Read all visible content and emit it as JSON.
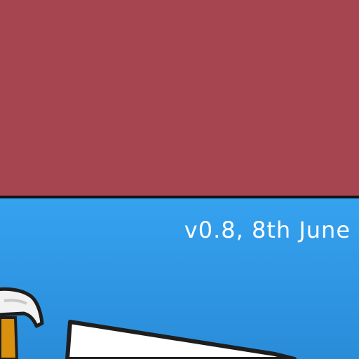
{
  "screen": {
    "version_label": "v0.8, 8th June"
  },
  "colors": {
    "top_panel": "#a6444f",
    "divider": "#141414",
    "bottom_gradient_top": "#35a2f0",
    "bottom_gradient_bottom": "#2a8cd8",
    "text": "#ffffff"
  }
}
